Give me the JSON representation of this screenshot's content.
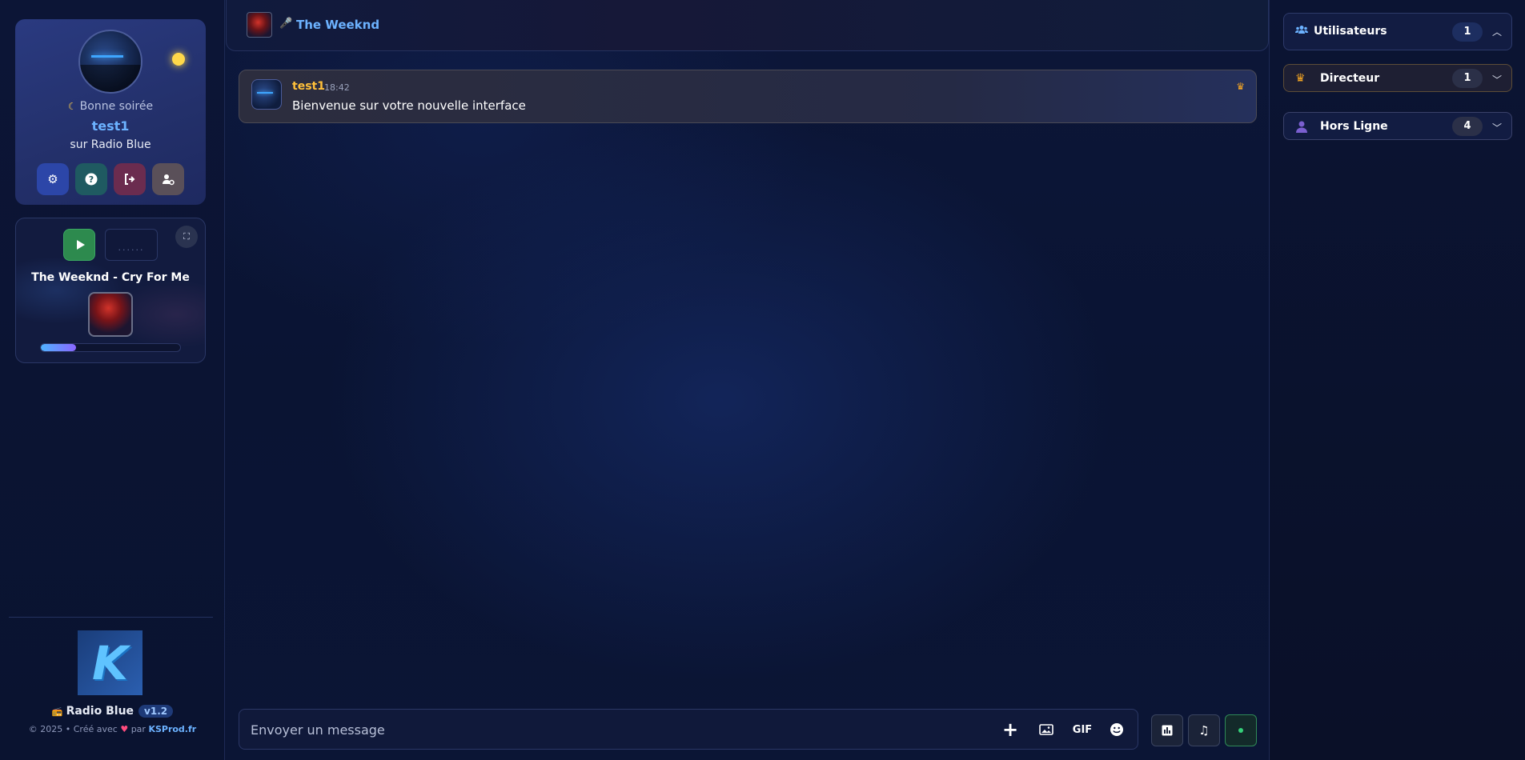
{
  "profile": {
    "greeting": "Bonne soirée",
    "greeting_icon": "moon-icon",
    "username": "test1",
    "server": "sur Radio Blue",
    "status_color": "#ffd84a",
    "actions": [
      "settings-icon",
      "help-icon",
      "logout-icon",
      "user-settings-icon"
    ]
  },
  "player": {
    "eq_text": "......",
    "now_playing": "The Weeknd - Cry For Me",
    "progress": 0.25
  },
  "brand": {
    "name": "Radio Blue",
    "version": "v1.2",
    "copyright_prefix": "© 2025 • Créé avec",
    "copyright_by": "par",
    "link": "KSProd.fr"
  },
  "topbar": {
    "artist": "The Weeknd"
  },
  "messages": [
    {
      "author": "test1",
      "time": "18:42",
      "text": "Bienvenue sur votre nouvelle interface",
      "role_icon": "crown-icon"
    }
  ],
  "composer": {
    "placeholder": "Envoyer un message",
    "gif_label": "GIF"
  },
  "groups": [
    {
      "label": "Utilisateurs",
      "count": "1",
      "icon": "users-icon",
      "expanded": true
    },
    {
      "label": "Directeur",
      "count": "1",
      "icon": "crown-icon",
      "expanded": false
    },
    {
      "label": "Hors Ligne",
      "count": "4",
      "icon": "user-icon",
      "expanded": false
    }
  ],
  "colors": {
    "accent": "#6cb2ff",
    "author": "#ffc03a",
    "live": "#35d07a"
  }
}
